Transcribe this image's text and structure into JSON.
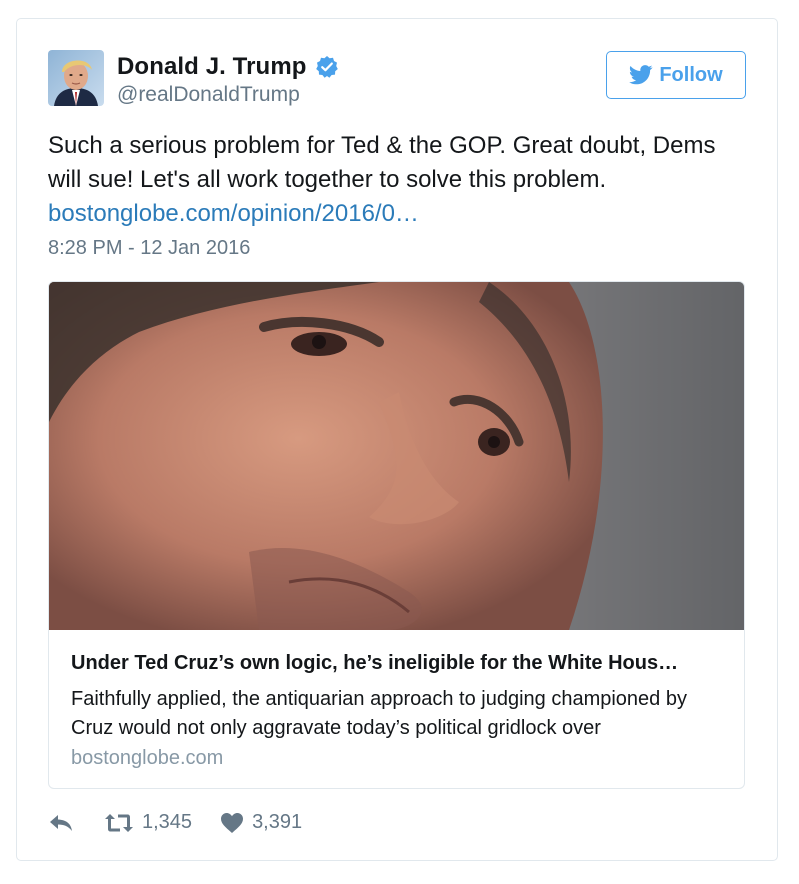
{
  "user": {
    "display_name": "Donald J. Trump",
    "handle": "@realDonaldTrump",
    "verified": true
  },
  "follow_label": "Follow",
  "tweet": {
    "text": "Such a serious problem for Ted & the GOP. Great doubt, Dems will sue! Let's all work together to solve this problem.",
    "link_text": "bostonglobe.com/opinion/2016/0…",
    "timestamp": "8:28 PM - 12 Jan 2016"
  },
  "card": {
    "title": "Under Ted Cruz’s own logic, he’s ineligible for the White Hous…",
    "description": "Faithfully applied, the antiquarian approach to judging championed by Cruz would not only aggravate today’s political gridlock over",
    "domain": "bostonglobe.com"
  },
  "stats": {
    "retweets": "1,345",
    "likes": "3,391"
  },
  "colors": {
    "accent": "#4aa1eb",
    "link": "#2b7bb9",
    "muted": "#657786",
    "border": "#e1e8ed"
  }
}
